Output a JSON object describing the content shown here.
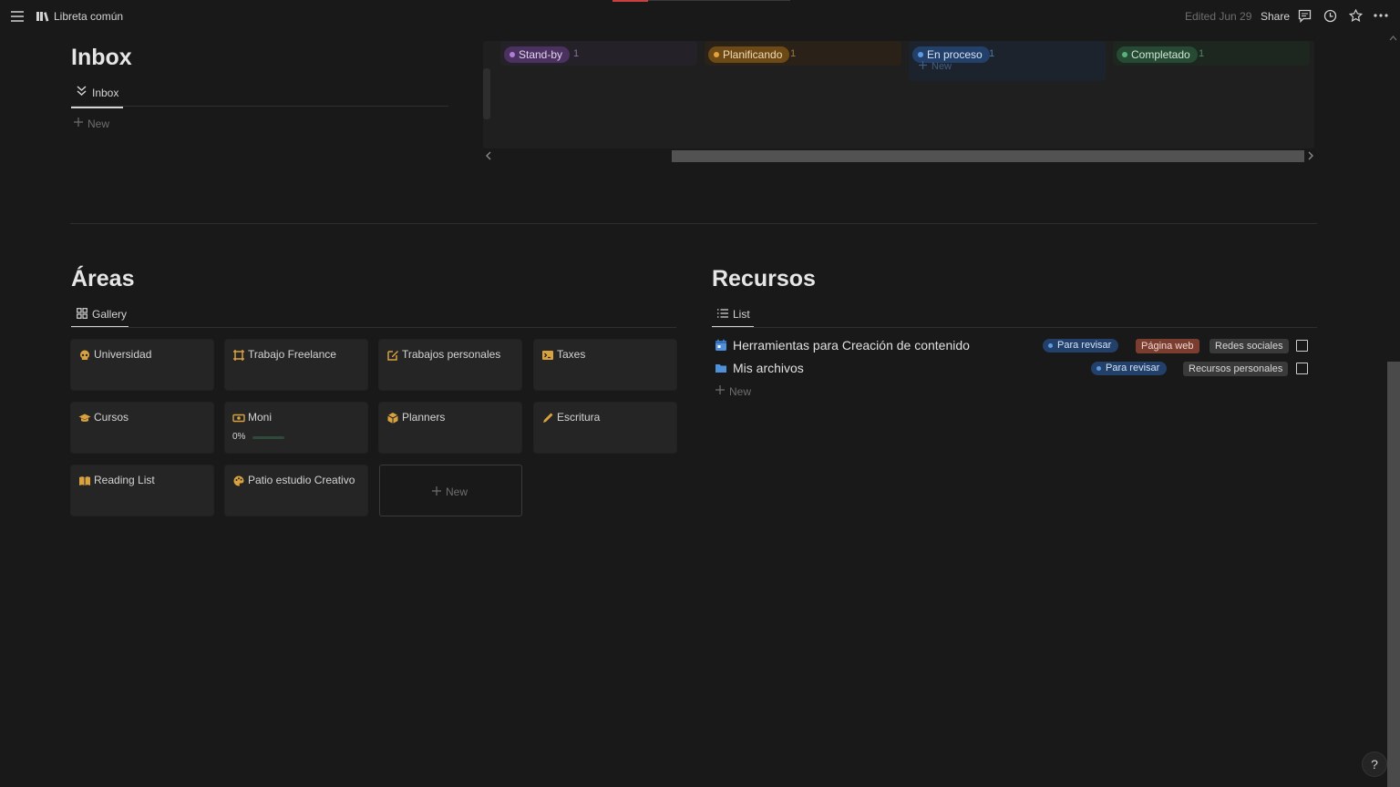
{
  "topbar": {
    "workspace_title": "Libreta común",
    "edited": "Edited Jun 29",
    "share": "Share"
  },
  "inbox": {
    "title": "Inbox",
    "view_tab": "Inbox",
    "new_label": "New"
  },
  "board": {
    "columns": [
      {
        "label": "Stand-by",
        "count": "1",
        "color": "#7b4fa0"
      },
      {
        "label": "Planificando",
        "count": "1",
        "color": "#9a6a1f"
      },
      {
        "label": "En proceso",
        "count": "1",
        "color": "#2c5a93"
      },
      {
        "label": "Completado",
        "count": "1",
        "color": "#2d6a45"
      }
    ],
    "new_label": "New"
  },
  "areas": {
    "title": "Áreas",
    "view_tab": "Gallery",
    "cards": [
      {
        "label": "Universidad",
        "icon": "skull-icon"
      },
      {
        "label": "Trabajo Freelance",
        "icon": "frame-icon"
      },
      {
        "label": "Trabajos personales",
        "icon": "edit-icon"
      },
      {
        "label": "Taxes",
        "icon": "terminal-icon"
      },
      {
        "label": "Cursos",
        "icon": "graduation-cap-icon"
      },
      {
        "label": "Moni",
        "icon": "money-icon",
        "progress_label": "0%",
        "progress": 0
      },
      {
        "label": "Planners",
        "icon": "cube-icon"
      },
      {
        "label": "Escritura",
        "icon": "pencil-icon"
      },
      {
        "label": "Reading List",
        "icon": "book-icon"
      },
      {
        "label": "Patio estudio Creativo",
        "icon": "palette-icon"
      }
    ],
    "new_label": "New"
  },
  "recursos": {
    "title": "Recursos",
    "view_tab": "List",
    "rows": [
      {
        "title": "Herramientas para Creación de contenido",
        "icon": "calendar-icon",
        "status": "Para revisar",
        "tags": [
          "Página web",
          "Redes sociales"
        ]
      },
      {
        "title": "Mis archivos",
        "icon": "folder-icon",
        "status": "Para revisar",
        "tags": [
          "Recursos personales"
        ]
      }
    ],
    "new_label": "New"
  },
  "help": "?",
  "colors": {
    "background": "#191919",
    "card": "#252525",
    "accent_icon": "#d9a23f",
    "status_blue": "#2c5a93",
    "tag_web": "#7a3d2f",
    "tag_gray": "#3a3a3a"
  }
}
